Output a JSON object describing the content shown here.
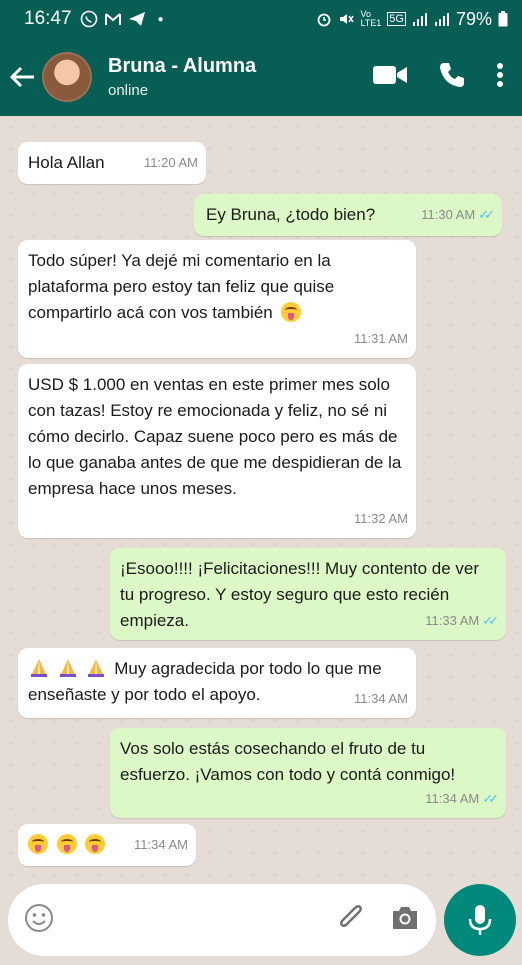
{
  "status_bar": {
    "time": "16:47",
    "battery": "79%",
    "network": "5G"
  },
  "header": {
    "name": "Bruna - Alumna",
    "status": "online"
  },
  "messages": [
    {
      "dir": "in",
      "text": "Hola Allan",
      "time": "11:20 AM"
    },
    {
      "dir": "out",
      "text": "Ey Bruna, ¿todo bien?",
      "time": "11:30 AM"
    },
    {
      "dir": "in",
      "text": "Todo súper! Ya dejé mi comentario en la plataforma pero estoy tan feliz que quise compartirlo acá con vos también",
      "time": "11:31 AM"
    },
    {
      "dir": "in",
      "text": "USD $ 1.000 en ventas en este primer mes solo con tazas! Estoy re emocionada y feliz, no sé ni cómo decirlo. Capaz suene poco pero es más de lo que ganaba antes de que me despidieran de la empresa hace unos meses.",
      "time": "11:32 AM"
    },
    {
      "dir": "out",
      "text": "¡Esooo!!!! ¡Felicitaciones!!! Muy contento de ver tu progreso. Y estoy seguro que esto recién empieza.",
      "time": "11:33 AM"
    },
    {
      "dir": "in",
      "text": "Muy agradecida por todo lo que me enseñaste y por todo el apoyo.",
      "time": "11:34 AM"
    },
    {
      "dir": "out",
      "text": "Vos solo estás cosechando el fruto de tu esfuerzo. ¡Vamos con todo y contá conmigo!",
      "time": "11:34 AM"
    },
    {
      "dir": "in",
      "text": "",
      "time": "11:34 AM"
    }
  ],
  "input": {
    "placeholder": ""
  },
  "colors": {
    "header": "#075e54",
    "outgoing": "#dcf8c6",
    "incoming": "#ffffff",
    "mic": "#00897b",
    "read_ticks": "#4fc3f7"
  }
}
